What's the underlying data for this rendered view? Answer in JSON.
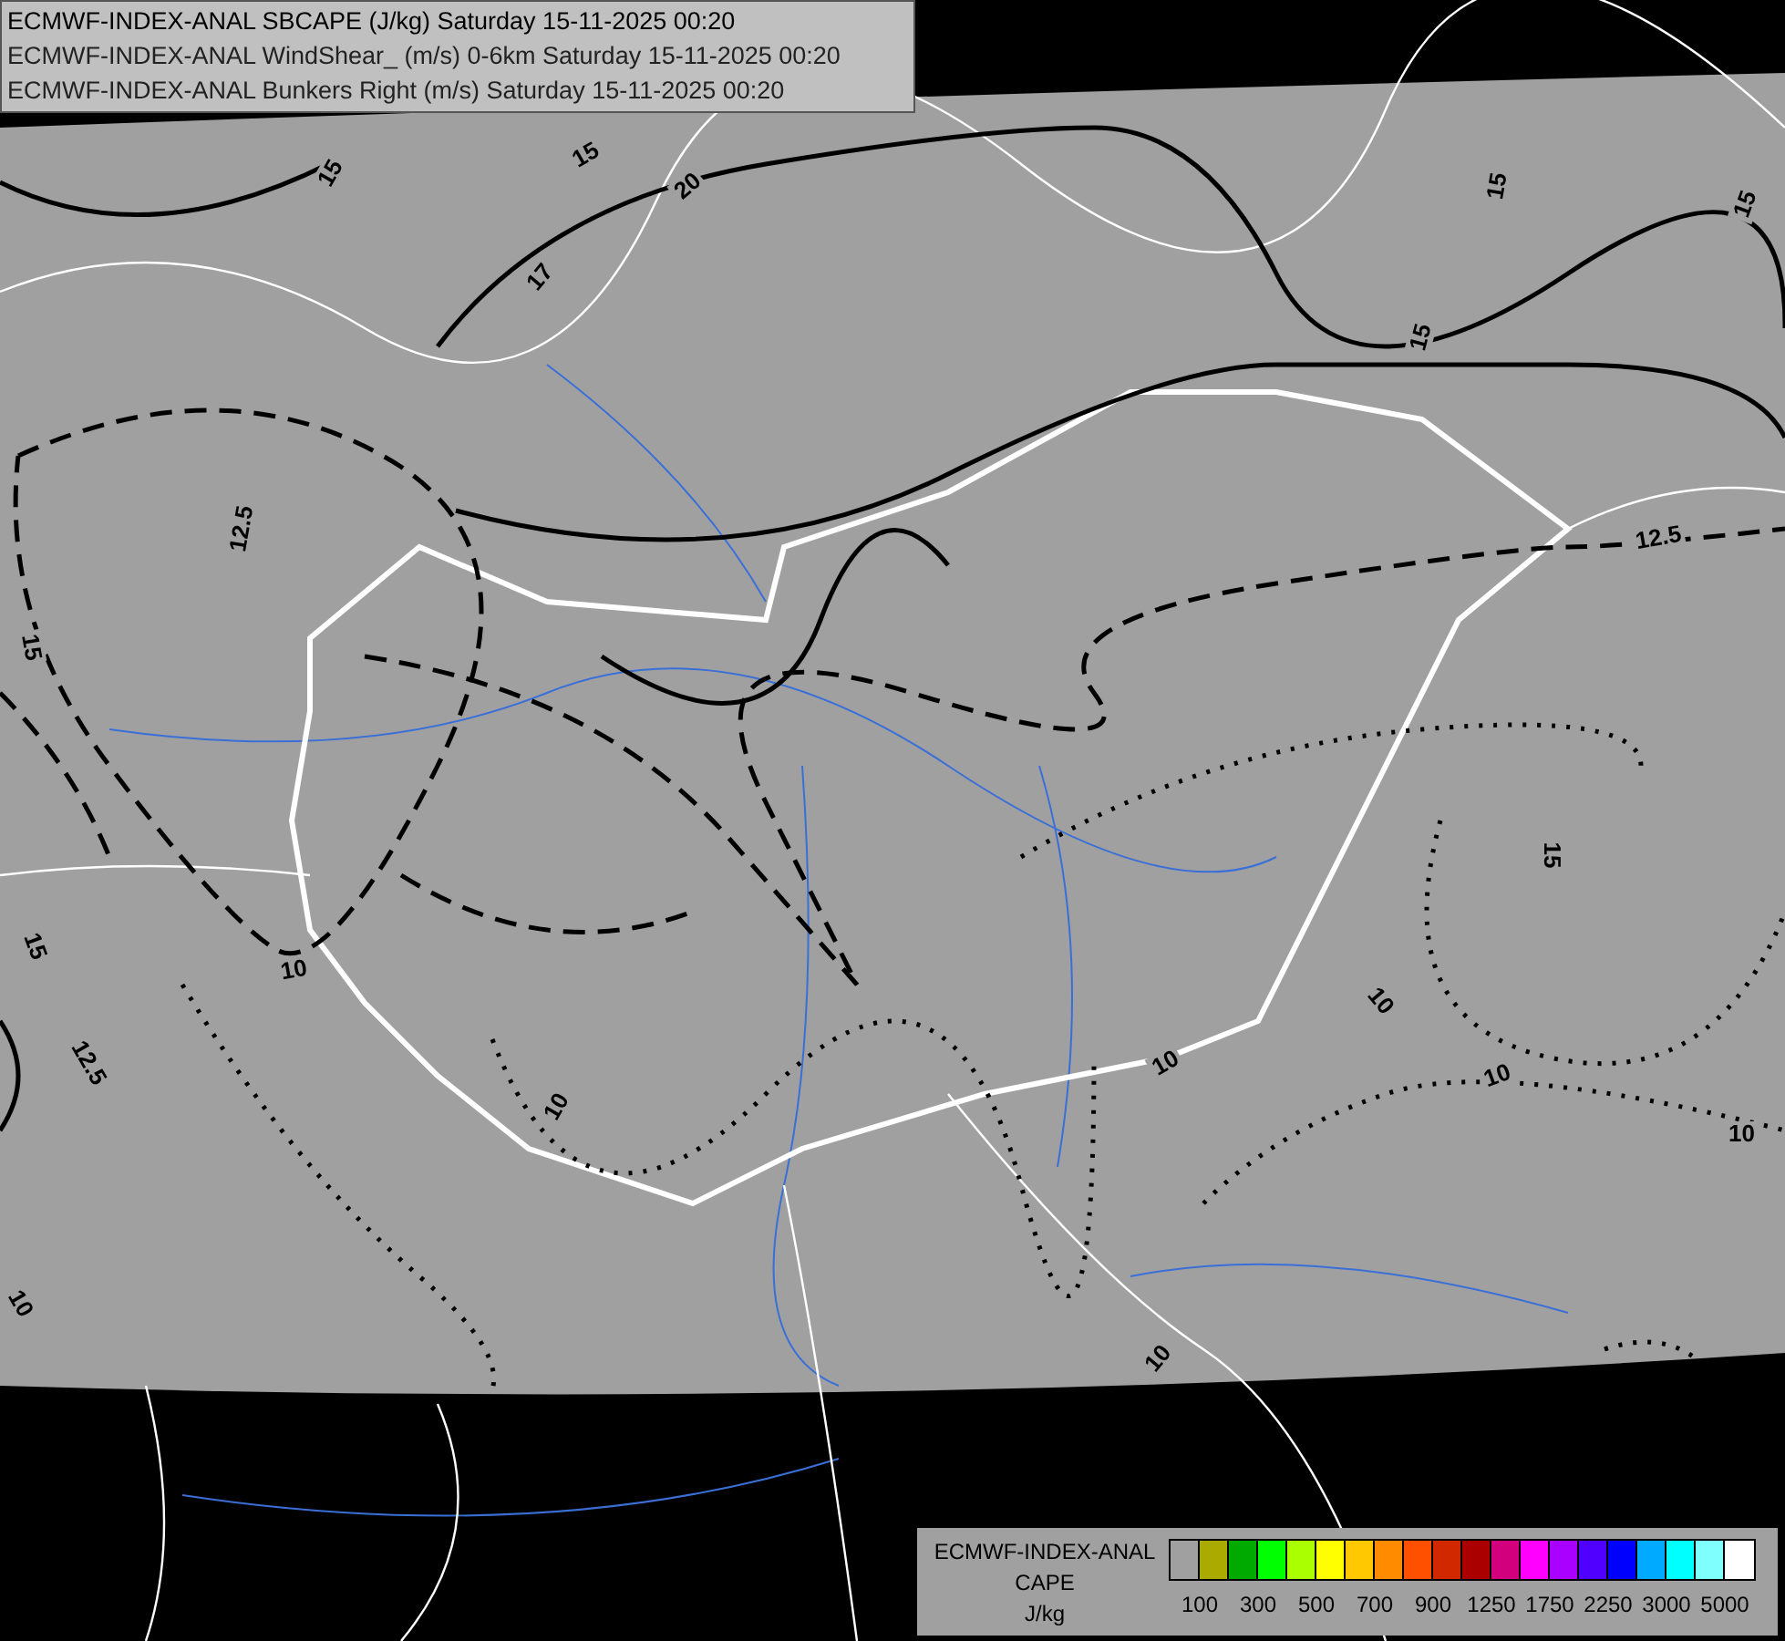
{
  "header": {
    "lines": [
      "ECMWF-INDEX-ANAL SBCAPE (J/kg) Saturday 15-11-2025 00:20",
      "ECMWF-INDEX-ANAL WindShear_ (m/s) 0-6km Saturday 15-11-2025 00:20",
      "ECMWF-INDEX-ANAL Bunkers Right (m/s) Saturday 15-11-2025 00:20"
    ]
  },
  "map": {
    "contour_labels": [
      {
        "text": "15"
      },
      {
        "text": "15"
      },
      {
        "text": "20"
      },
      {
        "text": "17"
      },
      {
        "text": "15"
      },
      {
        "text": "15"
      },
      {
        "text": "15"
      },
      {
        "text": "12.5"
      },
      {
        "text": "12.5"
      },
      {
        "text": "15"
      },
      {
        "text": "15"
      },
      {
        "text": "15"
      },
      {
        "text": "12.5"
      },
      {
        "text": "10"
      },
      {
        "text": "10"
      },
      {
        "text": "10"
      },
      {
        "text": "10"
      },
      {
        "text": "10"
      },
      {
        "text": "10"
      },
      {
        "text": "10"
      },
      {
        "text": "10"
      }
    ]
  },
  "legend": {
    "title_lines": [
      "ECMWF-INDEX-ANAL",
      "CAPE",
      "J/kg"
    ],
    "swatches": [
      {
        "color": "#a0a0a0"
      },
      {
        "color": "#aaaa00"
      },
      {
        "color": "#00aa00"
      },
      {
        "color": "#00ff00"
      },
      {
        "color": "#aaff00"
      },
      {
        "color": "#ffff00"
      },
      {
        "color": "#ffc800"
      },
      {
        "color": "#ff8c00"
      },
      {
        "color": "#ff5000"
      },
      {
        "color": "#d22800"
      },
      {
        "color": "#aa0000"
      },
      {
        "color": "#d2007d"
      },
      {
        "color": "#ff00ff"
      },
      {
        "color": "#aa00ff"
      },
      {
        "color": "#5000ff"
      },
      {
        "color": "#0000ff"
      },
      {
        "color": "#00aaff"
      },
      {
        "color": "#00ffff"
      },
      {
        "color": "#80ffff"
      },
      {
        "color": "#ffffff"
      }
    ],
    "labels": [
      "100",
      "300",
      "500",
      "700",
      "900",
      "1250",
      "1750",
      "2250",
      "3000",
      "5000"
    ]
  }
}
